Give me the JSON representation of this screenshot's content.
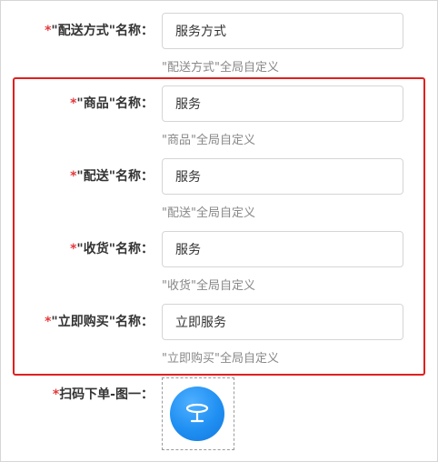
{
  "form": {
    "required_mark": "*",
    "fields": [
      {
        "label": "\"配送方式\"名称：",
        "value": "服务方式",
        "hint": "\"配送方式\"全局自定义"
      },
      {
        "label": "\"商品\"名称：",
        "value": "服务",
        "hint": "\"商品\"全局自定义"
      },
      {
        "label": "\"配送\"名称：",
        "value": "服务",
        "hint": "\"配送\"全局自定义"
      },
      {
        "label": "\"收货\"名称：",
        "value": "服务",
        "hint": "\"收货\"全局自定义"
      },
      {
        "label": "\"立即购买\"名称：",
        "value": "立即服务",
        "hint": "\"立即购买\"全局自定义"
      }
    ],
    "upload": {
      "label": "扫码下单-图一：",
      "icon": "table-icon"
    }
  },
  "colors": {
    "required": "#e4393c",
    "highlight_border": "#e02020",
    "icon_blue": "#1f8ff2"
  }
}
